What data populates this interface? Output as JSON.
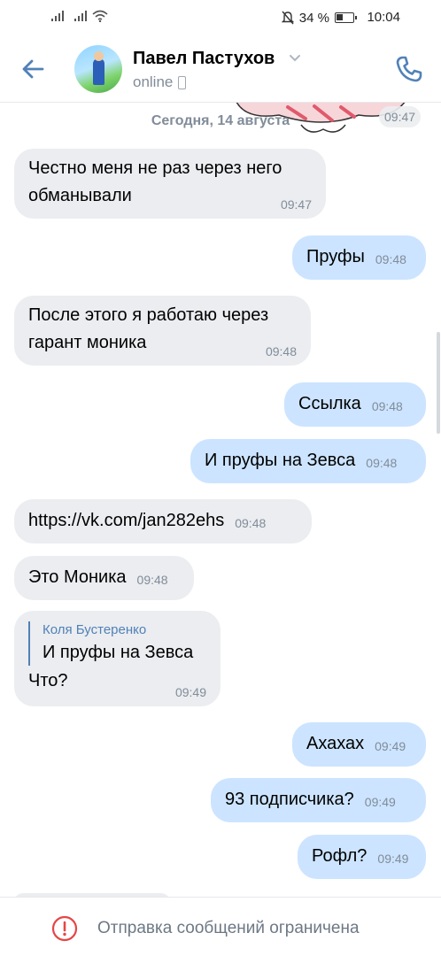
{
  "status_bar": {
    "battery_percent": "34 %",
    "time": "10:04",
    "icons": [
      "signal-icon",
      "signal-icon",
      "wifi-icon",
      "mute-icon",
      "battery-icon"
    ]
  },
  "header": {
    "contact_name": "Павел Пастухов",
    "presence": "online",
    "icons": [
      "back-arrow-icon",
      "chevron-down-icon",
      "mobile-phone-icon",
      "phone-call-icon"
    ]
  },
  "chat": {
    "date_separator": "Сегодня, 14 августа",
    "sticker_time": "09:47",
    "messages": [
      {
        "dir": "in",
        "text": "Честно меня не раз через него обманывали",
        "time": "09:47"
      },
      {
        "dir": "out",
        "text": "Пруфы",
        "time": "09:48"
      },
      {
        "dir": "in",
        "text": "После этого я работаю через гарант моника",
        "time": "09:48"
      },
      {
        "dir": "out",
        "text": "Ссылка",
        "time": "09:48"
      },
      {
        "dir": "out",
        "text": "И пруфы на Зевса",
        "time": "09:48"
      },
      {
        "dir": "in",
        "text": "https://vk.com/jan282ehs",
        "time": "09:48",
        "is_link": true
      },
      {
        "dir": "in",
        "text": "Это Моника",
        "time": "09:48"
      },
      {
        "dir": "in",
        "reply_author": "Коля Бустеренко",
        "reply_text": "И пруфы на Зевса",
        "text": "Что?",
        "time": "09:49"
      },
      {
        "dir": "out",
        "text": "Ахахах",
        "time": "09:49"
      },
      {
        "dir": "out",
        "text": "93 подписчика?",
        "time": "09:49"
      },
      {
        "dir": "out",
        "text": "Рофл?",
        "time": "09:49"
      }
    ]
  },
  "footer": {
    "notice": "Отправка сообщений ограничена",
    "icon": "warning-icon"
  },
  "colors": {
    "accent": "#5181b8",
    "incoming_bubble": "#ebedf0",
    "outgoing_bubble": "#cce4ff",
    "secondary_text": "#818c99",
    "link": "#2a5885",
    "warning": "#e64646"
  }
}
